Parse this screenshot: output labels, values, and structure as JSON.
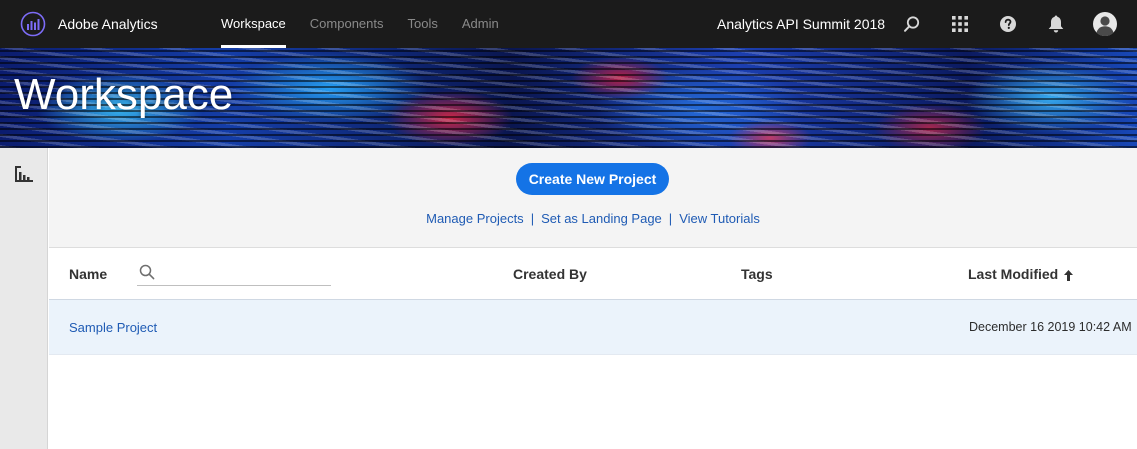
{
  "topbar": {
    "app_name": "Adobe Analytics",
    "nav": [
      {
        "label": "Workspace",
        "active": true
      },
      {
        "label": "Components",
        "active": false
      },
      {
        "label": "Tools",
        "active": false
      },
      {
        "label": "Admin",
        "active": false
      }
    ],
    "company": "Analytics API Summit 2018",
    "icons": [
      "search-icon",
      "apps-grid-icon",
      "help-icon",
      "notifications-bell-icon",
      "user-avatar-icon"
    ]
  },
  "hero": {
    "title": "Workspace"
  },
  "leftrail": {
    "icon": "projects-panel-icon"
  },
  "actions": {
    "create_label": "Create New Project",
    "links": [
      "Manage Projects",
      "Set as Landing Page",
      "View Tutorials"
    ],
    "separator": "|"
  },
  "table": {
    "columns": {
      "name": "Name",
      "created_by": "Created By",
      "tags": "Tags",
      "last_modified": "Last Modified"
    },
    "search": {
      "value": "",
      "placeholder": ""
    },
    "sort": {
      "column": "last_modified",
      "direction": "ascending-arrow"
    },
    "rows": [
      {
        "name": "Sample Project",
        "created_by": "",
        "tags": "",
        "last_modified": "December 16 2019 10:42 AM"
      }
    ]
  },
  "colors": {
    "topbar_bg": "#1b1b1b",
    "accent_blue": "#1473e6",
    "link_blue": "#1f5bb4",
    "row_selected_bg": "#ebf3fb"
  }
}
